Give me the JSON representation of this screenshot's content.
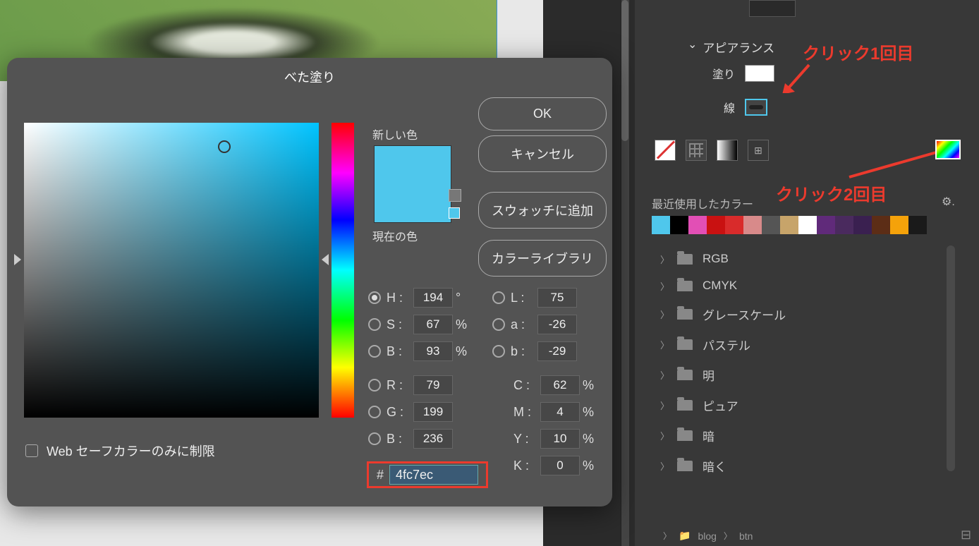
{
  "dialog": {
    "title": "べた塗り",
    "new_color_label": "新しい色",
    "current_color_label": "現在の色",
    "ok": "OK",
    "cancel": "キャンセル",
    "add_swatch": "スウォッチに追加",
    "color_library": "カラーライブラリ",
    "web_safe": "Web セーフカラーのみに制限",
    "hex": "4fc7ec",
    "values": {
      "H": {
        "label": "H :",
        "val": "194",
        "unit": "°"
      },
      "S": {
        "label": "S :",
        "val": "67",
        "unit": "%"
      },
      "Bv": {
        "label": "B :",
        "val": "93",
        "unit": "%"
      },
      "L": {
        "label": "L :",
        "val": "75",
        "unit": ""
      },
      "a": {
        "label": "a :",
        "val": "-26",
        "unit": ""
      },
      "b": {
        "label": "b :",
        "val": "-29",
        "unit": ""
      },
      "R": {
        "label": "R :",
        "val": "79",
        "unit": ""
      },
      "G": {
        "label": "G :",
        "val": "199",
        "unit": ""
      },
      "Bc": {
        "label": "B :",
        "val": "236",
        "unit": ""
      },
      "C": {
        "label": "C :",
        "val": "62",
        "unit": "%"
      },
      "M": {
        "label": "M :",
        "val": "4",
        "unit": "%"
      },
      "Y": {
        "label": "Y :",
        "val": "10",
        "unit": "%"
      },
      "K": {
        "label": "K :",
        "val": "0",
        "unit": "%"
      }
    }
  },
  "panel": {
    "appearance": "アピアランス",
    "fill": "塗り",
    "stroke": "線",
    "recent": "最近使用したカラー",
    "swatch_colors": [
      "#4fc7ec",
      "#000000",
      "#e24fb5",
      "#c91111",
      "#d92b2b",
      "#d88a8a",
      "#555555",
      "#c7a46a",
      "#ffffff",
      "#602a7a",
      "#4a2a5e",
      "#3a2050",
      "#5c2d16",
      "#f5a20a",
      "#1a1a1a"
    ],
    "folders": [
      "RGB",
      "CMYK",
      "グレースケール",
      "パステル",
      "明",
      "ピュア",
      "暗",
      "暗く"
    ],
    "breadcrumb": [
      "blog",
      "btn"
    ]
  },
  "annotations": {
    "click1": "クリック1回目",
    "click2": "クリック2回目"
  }
}
